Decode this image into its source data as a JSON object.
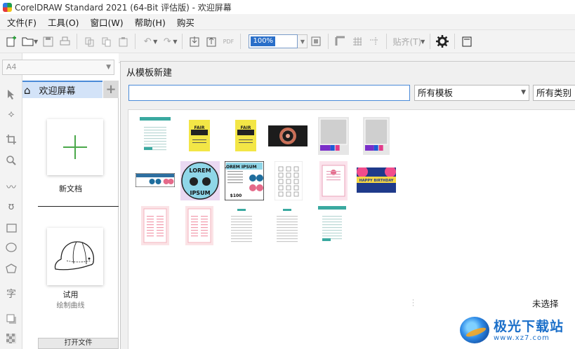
{
  "window": {
    "title": "CorelDRAW Standard 2021 (64-Bit 评估版) - 欢迎屏幕"
  },
  "menu": [
    "文件(F)",
    "工具(O)",
    "窗口(W)",
    "帮助(H)",
    "购买"
  ],
  "toolbar": {
    "zoom_value": "100%",
    "pdf_label": "PDF",
    "paste_label": "贴齐(T)"
  },
  "page_size": "A4",
  "welcome": {
    "tab_label": "欢迎屏幕",
    "new_doc_label": "新文档",
    "trial_label": "试用",
    "trial_sub": "绘制曲线",
    "open_file_label": "打开文件"
  },
  "dialog": {
    "title": "从模板新建",
    "search_value": "",
    "template_filter": "所有模板",
    "category_filter": "所有类别",
    "selection_status": "未选择"
  },
  "templates": [
    {
      "name": "report-teal",
      "style": "doc-teal"
    },
    {
      "name": "yellow-flyer-1",
      "style": "fair-yellow",
      "text": "FAIR"
    },
    {
      "name": "yellow-flyer-2",
      "style": "fair-yellow",
      "text": "FAIR"
    },
    {
      "name": "mandala-banner",
      "style": "mandala"
    },
    {
      "name": "swatch-grid-1",
      "style": "swatches"
    },
    {
      "name": "swatch-grid-2",
      "style": "swatches"
    },
    {
      "name": "sunglasses-banner",
      "style": "glasses-banner"
    },
    {
      "name": "lorem-ipsum-circle",
      "style": "lorem-circle",
      "text1": "LOREM",
      "text2": "IPSUM"
    },
    {
      "name": "lorem-ipsum-card",
      "style": "lorem-card",
      "text1": "LOREM IPSUM",
      "text2": "$100"
    },
    {
      "name": "icon-sheet",
      "style": "icon-sheet"
    },
    {
      "name": "pink-invite",
      "style": "pink-invite"
    },
    {
      "name": "happy-birthday-banner",
      "style": "birthday",
      "text": "HAPPY BIRTHDAY"
    },
    {
      "name": "pink-menu-1",
      "style": "pink-menu"
    },
    {
      "name": "pink-menu-2",
      "style": "pink-menu"
    },
    {
      "name": "letter-1",
      "style": "letter"
    },
    {
      "name": "letter-2",
      "style": "letter"
    },
    {
      "name": "report-teal-2",
      "style": "doc-teal"
    }
  ],
  "watermark": {
    "main": "极光下载站",
    "url": "www.xz7.com"
  },
  "colors": {
    "accent": "#4a8ad8",
    "tab_active": "#d3e3f8",
    "plus_green": "#4aa84a",
    "flyer_yellow": "#f3e646"
  }
}
